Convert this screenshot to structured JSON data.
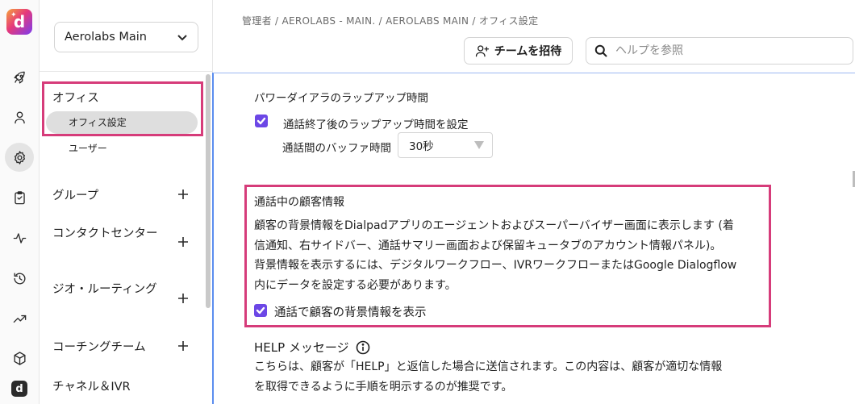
{
  "rail": {
    "logo_letter": "d",
    "icons": [
      "rocket-icon",
      "person-icon",
      "gear-icon",
      "clipboard-icon",
      "activity-icon",
      "history-icon",
      "trending-icon",
      "cube-icon",
      "dialpad-app-icon"
    ],
    "mini_letter": "d"
  },
  "nav": {
    "workspace": "Aerolabs Main",
    "sections": [
      {
        "label": "オフィス",
        "items": [
          "オフィス設定",
          "ユーザー"
        ]
      },
      {
        "label": "グループ"
      },
      {
        "label": "コンタクトセンター"
      },
      {
        "label": "ジオ・ルーティング"
      },
      {
        "label": "コーチングチーム"
      },
      {
        "label": "チャネル＆IVR"
      }
    ]
  },
  "header": {
    "breadcrumb": "管理者 / AEROLABS - MAIN. / AEROLABS MAIN / オフィス設定",
    "invite_label": "チームを招待",
    "search_placeholder": "ヘルプを参照"
  },
  "wrapup": {
    "title": "パワーダイアラのラップアップ時間",
    "checkbox_label": "通話終了後のラップアップ時間を設定",
    "checkbox_checked": true,
    "buffer_label": "通話間のバッファ時間",
    "buffer_value": "30秒"
  },
  "customer_info": {
    "title": "通話中の顧客情報",
    "lines": [
      "顧客の背景情報をDialpadアプリのエージェントおよびスーパーバイザー画面に表示します (着",
      "信通知、右サイドバー、通話サマリー画面および保留キュータブのアカウント情報パネル)。",
      "背景情報を表示するには、デジタルワークフロー、IVRワークフローまたはGoogle Dialogflow",
      "内にデータを設定する必要があります。"
    ],
    "checkbox_label": "通話で顧客の背景情報を表示",
    "checkbox_checked": true
  },
  "help": {
    "title": "HELP メッセージ",
    "lines": [
      "こちらは、顧客が「HELP」と返信した場合に送信されます。この内容は、顧客が適切な情報",
      "を取得できるように手順を明示するのが推奨です。"
    ]
  },
  "colors": {
    "highlight": "#d63c7a",
    "checkbox": "#6c47e6",
    "focus": "#5b8def"
  }
}
